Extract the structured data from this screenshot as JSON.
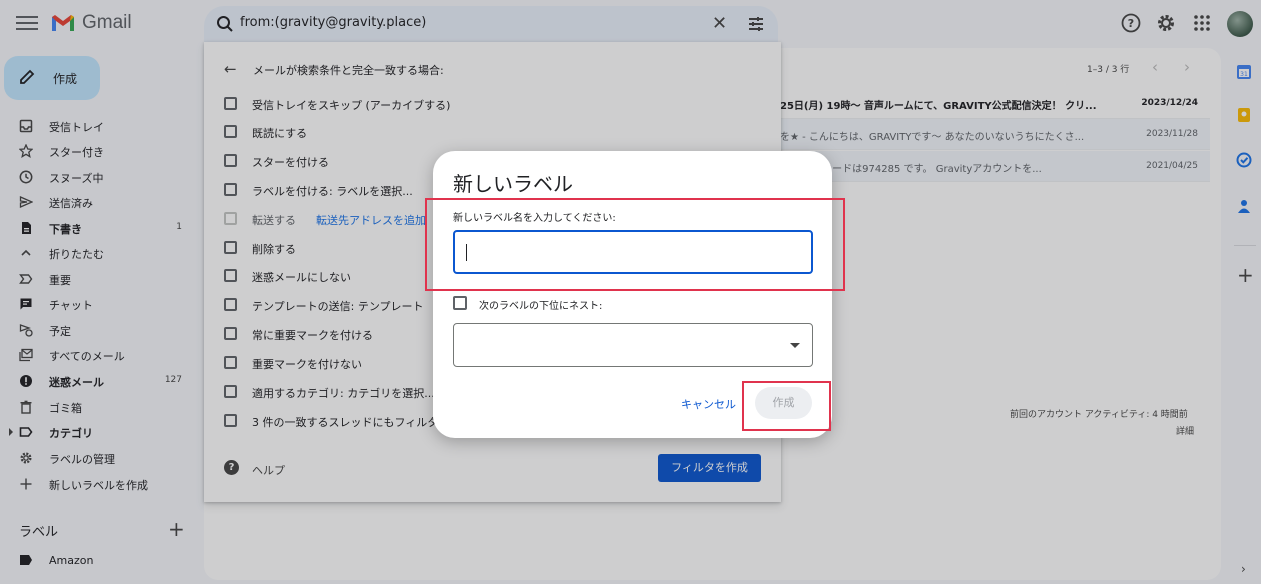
{
  "topbar": {
    "app_name": "Gmail",
    "search_value": "from:(gravity@gravity.place)",
    "icons": [
      "menu-icon",
      "search-icon",
      "close-icon",
      "tune-icon",
      "help-icon",
      "gear-icon",
      "apps-icon"
    ]
  },
  "sidebar": {
    "compose_label": "作成",
    "items": [
      {
        "label": "受信トレイ",
        "icon": "inbox-icon",
        "count": "",
        "bold": false
      },
      {
        "label": "スター付き",
        "icon": "star-icon",
        "count": "",
        "bold": false
      },
      {
        "label": "スヌーズ中",
        "icon": "clock-icon",
        "count": "",
        "bold": false
      },
      {
        "label": "送信済み",
        "icon": "send-icon",
        "count": "",
        "bold": false
      },
      {
        "label": "下書き",
        "icon": "draft-icon",
        "count": "1",
        "bold": true
      },
      {
        "label": "折りたたむ",
        "icon": "chevron-up-icon",
        "count": "",
        "bold": false
      },
      {
        "label": "重要",
        "icon": "important-icon",
        "count": "",
        "bold": false
      },
      {
        "label": "チャット",
        "icon": "chat-icon",
        "count": "",
        "bold": false
      },
      {
        "label": "予定",
        "icon": "scheduled-icon",
        "count": "",
        "bold": false
      },
      {
        "label": "すべてのメール",
        "icon": "all-mail-icon",
        "count": "",
        "bold": false
      },
      {
        "label": "迷惑メール",
        "icon": "spam-icon",
        "count": "127",
        "bold": true
      },
      {
        "label": "ゴミ箱",
        "icon": "trash-icon",
        "count": "",
        "bold": false
      },
      {
        "label": "カテゴリ",
        "icon": "label-icon",
        "count": "",
        "bold": true
      },
      {
        "label": "ラベルの管理",
        "icon": "gear-icon",
        "count": "",
        "bold": false
      },
      {
        "label": "新しいラベルを作成",
        "icon": "plus-icon",
        "count": "",
        "bold": false
      }
    ],
    "labels_header": "ラベル",
    "label_items": [
      {
        "label": "Amazon"
      }
    ]
  },
  "mail_list": {
    "pager": "1–3 / 3 行",
    "rows": [
      {
        "snippet": "25日(月) 19時〜 音声ルームにて、GRAVITY公式配信決定！ クリ...",
        "date": "2023/12/24",
        "bold": true
      },
      {
        "snippet": "を★ - こんにちは、GRAVITYです〜 あなたのいないうちにたくさ...",
        "date": "2023/11/28",
        "bold": false
      },
      {
        "snippet": "す。 確認コードは974285 です。 Gravityアカウントを...",
        "date": "2021/04/25",
        "bold": false
      }
    ],
    "activity": "前回のアカウント アクティビティ: 4 時間前",
    "details": "詳細"
  },
  "filter_panel": {
    "title": "メールが検索条件と完全一致する場合:",
    "options": [
      {
        "label": "受信トレイをスキップ (アーカイブする)",
        "link": "",
        "disabled": false
      },
      {
        "label": "既読にする",
        "link": "",
        "disabled": false
      },
      {
        "label": "スターを付ける",
        "link": "",
        "disabled": false
      },
      {
        "label": "ラベルを付ける: ラベルを選択...",
        "link": "",
        "disabled": false
      },
      {
        "label": "転送する",
        "link": "転送先アドレスを追加",
        "disabled": true
      },
      {
        "label": "削除する",
        "link": "",
        "disabled": false
      },
      {
        "label": "迷惑メールにしない",
        "link": "",
        "disabled": false
      },
      {
        "label": "テンプレートの送信: テンプレート",
        "link": "",
        "disabled": false
      },
      {
        "label": "常に重要マークを付ける",
        "link": "",
        "disabled": false
      },
      {
        "label": "重要マークを付けない",
        "link": "",
        "disabled": false
      },
      {
        "label": "適用するカテゴリ: カテゴリを選択...",
        "link": "",
        "disabled": false
      },
      {
        "label": "3 件の一致するスレッドにもフィルタ",
        "link": "",
        "disabled": false
      }
    ],
    "help": "ヘルプ",
    "create_button": "フィルタを作成"
  },
  "modal": {
    "title": "新しいラベル",
    "name_label": "新しいラベル名を入力してください:",
    "name_value": "",
    "nest_label": "次のラベルの下位にネスト:",
    "nest_checked": false,
    "parent_select_value": "",
    "cancel_label": "キャンセル",
    "create_label": "作成"
  },
  "colors": {
    "accent": "#0b57d0",
    "compose_bg": "#c2e7ff",
    "highlight": "#e0334d"
  }
}
